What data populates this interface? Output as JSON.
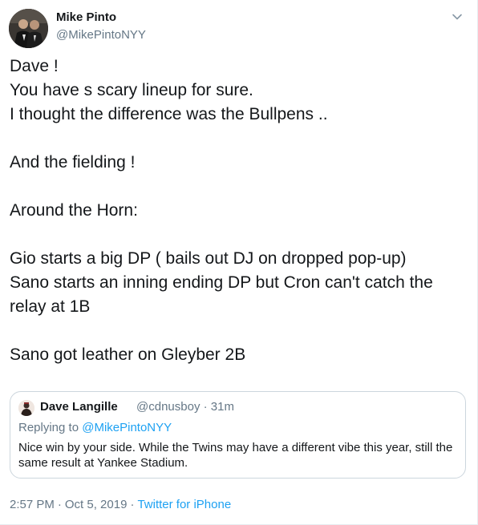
{
  "author": {
    "name": "Mike Pinto",
    "handle": "@MikePintoNYY",
    "avatar_icon": "profile-photo-two-people"
  },
  "menu_icon": "chevron-down-icon",
  "body_lines": [
    "Dave !",
    "You have s scary lineup for sure.",
    "I thought the difference was the Bullpens ..",
    "",
    "And the fielding !",
    "",
    "Around the Horn:",
    "",
    "Gio starts a big DP ( bails out DJ on dropped pop-up)",
    "Sano starts an inning ending DP but Cron can't catch the",
    "relay at 1B",
    "",
    "Sano got leather on Gleyber 2B"
  ],
  "quoted_tweet": {
    "name": "Dave Langille",
    "handle": "@cdnusboy",
    "time": "31m",
    "replying_prefix": "Replying to",
    "replying_to": "@MikePintoNYY",
    "text": "Nice win by your side.  While the Twins may have a different vibe this year, still the same result at Yankee Stadium.",
    "avatar_icon": "profile-photo-person"
  },
  "timestamp": {
    "time": "2:57 PM",
    "date": "Oct 5, 2019",
    "source": "Twitter for iPhone"
  },
  "colors": {
    "text": "#14171a",
    "secondary": "#657786",
    "link": "#1da1f2",
    "border": "#ccd6dd"
  }
}
